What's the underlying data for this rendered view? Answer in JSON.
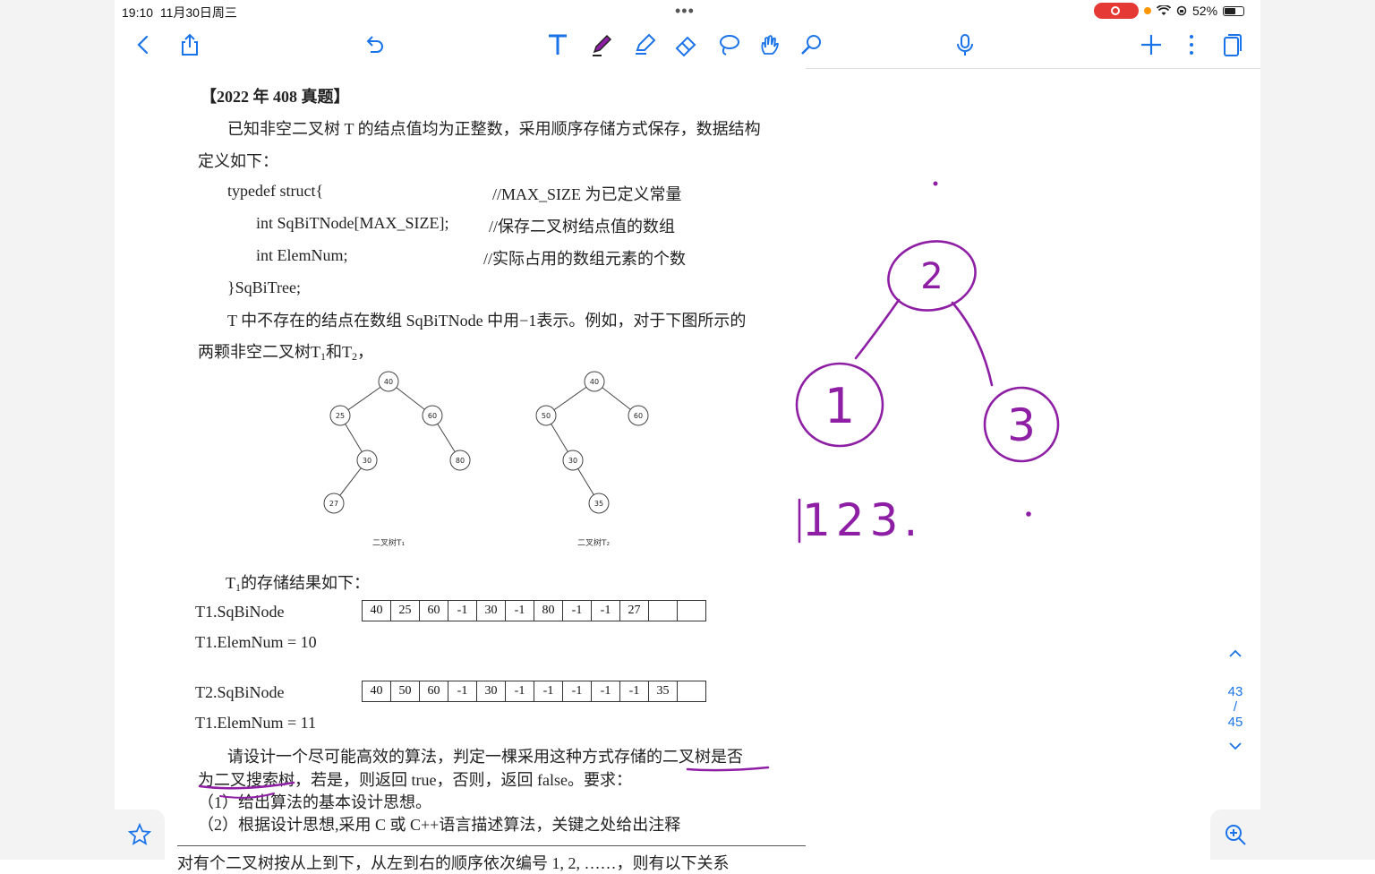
{
  "status": {
    "time": "19:10",
    "date": "11月30日周三",
    "battery": "52%"
  },
  "doc": {
    "heading": "【2022 年 408 真题】",
    "intro1": "已知非空二叉树 T 的结点值均为正整数，采用顺序存储方式保存，数据结构",
    "intro2": "定义如下：",
    "code1": "typedef struct{",
    "code1_comment": "//MAX_SIZE 为已定义常量",
    "code2": "int SqBiTNode[MAX_SIZE];",
    "code2_comment": "//保存二叉树结点值的数组",
    "code3": "int ElemNum;",
    "code3_comment": "//实际占用的数组元素的个数",
    "code4": "}SqBiTree;",
    "desc1": "T 中不存在的结点在数组 SqBiTNode 中用−1表示。例如，对于下图所示的",
    "desc2_prefix": "两颗非空二叉树T",
    "desc2_and": "和T",
    "desc2_suffix": "，",
    "sub1": "1",
    "sub2": "2",
    "tree1_caption": "二叉树T₁",
    "tree2_caption": "二叉树T₂",
    "tree1_nodes": [
      "40",
      "25",
      "60",
      "30",
      "80",
      "27"
    ],
    "tree2_nodes": [
      "40",
      "50",
      "60",
      "30",
      "35"
    ],
    "storage_title_prefix": "T",
    "storage_title_suffix": "的存储结果如下：",
    "t1_label": "T1.SqBiNode",
    "t1_values": [
      "40",
      "25",
      "60",
      "-1",
      "30",
      "-1",
      "80",
      "-1",
      "-1",
      "27",
      "",
      ""
    ],
    "t1_elem": "T1.ElemNum = 10",
    "t2_label": "T2.SqBiNode",
    "t2_values": [
      "40",
      "50",
      "60",
      "-1",
      "30",
      "-1",
      "-1",
      "-1",
      "-1",
      "-1",
      "35",
      ""
    ],
    "t2_elem": "T1.ElemNum = 11",
    "q1": "请设计一个尽可能高效的算法，判定一棵采用这种方式存储的二叉树是否",
    "q2": "为二叉搜索树，若是，则返回 true，否则，返回 false。要求：",
    "q3": "（1）给出算法的基本设计思想。",
    "q4": "（2）根据设计思想,采用 C 或 C++语言描述算法，关键之处给出注释",
    "cut": "对有个二叉树按从上到下，从左到右的顺序依次编号 1, 2, ……，则有以下关系"
  },
  "handwriting": {
    "nodes": [
      "2",
      "1",
      "3"
    ],
    "sequence": "123."
  },
  "pager": {
    "current": "43",
    "sep": "/",
    "total": "45"
  },
  "colors": {
    "accent": "#1a73e8",
    "ink": "#8e1fa5"
  }
}
